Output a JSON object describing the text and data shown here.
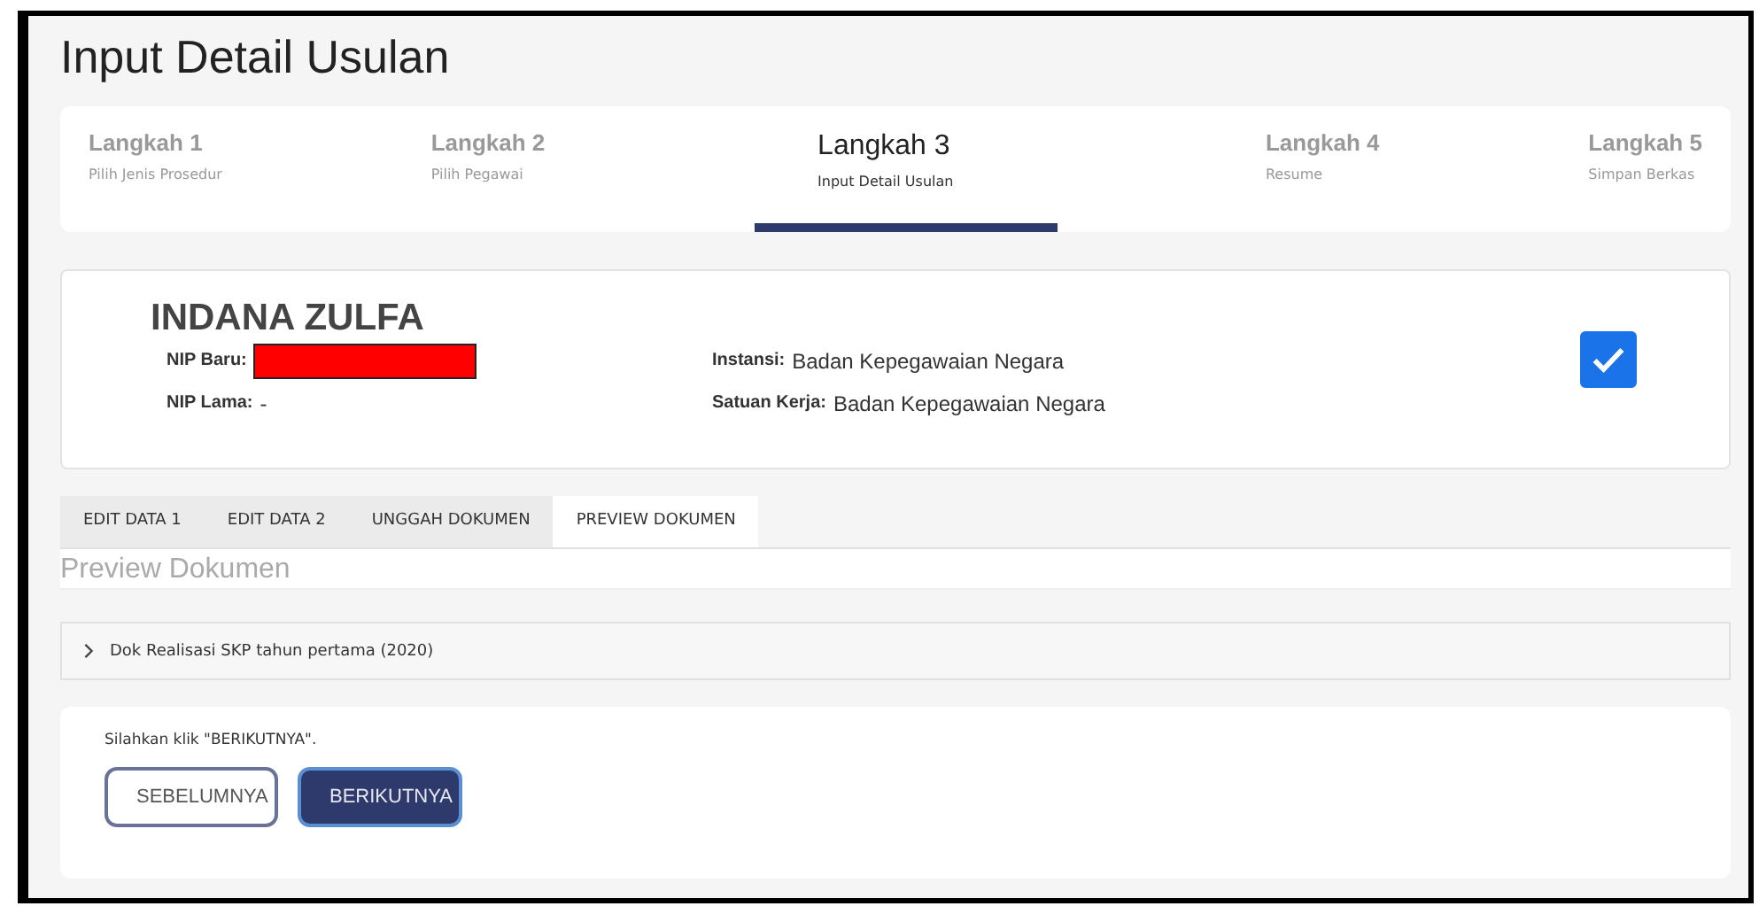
{
  "page_title": "Input Detail Usulan",
  "steps": [
    {
      "label": "Langkah 1",
      "caption": "Pilih Jenis Prosedur",
      "selected": false
    },
    {
      "label": "Langkah 2",
      "caption": "Pilih Pegawai",
      "selected": false
    },
    {
      "label": "Langkah 3",
      "caption": "Input Detail Usulan",
      "selected": true
    },
    {
      "label": "Langkah 4",
      "caption": "Resume",
      "selected": false
    },
    {
      "label": "Langkah 5",
      "caption": "Simpan Berkas",
      "selected": false
    }
  ],
  "employee": {
    "name": "INDANA ZULFA",
    "checked": true,
    "left_fields": [
      {
        "label": "NIP Baru:",
        "kind": "redacted"
      },
      {
        "label": "NIP Lama:",
        "kind": "text",
        "value": "-"
      }
    ],
    "right_fields": [
      {
        "label": "Instansi:",
        "kind": "text",
        "value": "Badan Kepegawaian Negara"
      },
      {
        "label": "Satuan Kerja:",
        "kind": "text",
        "value": "Badan Kepegawaian Negara"
      }
    ]
  },
  "tabs": [
    {
      "label": "EDIT DATA 1",
      "selected": false
    },
    {
      "label": "EDIT DATA 2",
      "selected": false
    },
    {
      "label": "UNGGAH DOKUMEN",
      "selected": false
    },
    {
      "label": "PREVIEW DOKUMEN",
      "selected": true
    }
  ],
  "section_title": "Preview Dokumen",
  "documents": [
    {
      "label": "Dok Realisasi SKP tahun pertama (2020)",
      "expanded": false
    }
  ],
  "instruction": "Silahkan klik \"BERIKUTNYA\".",
  "buttons": [
    {
      "label": "SEBELUMNYA",
      "kind": "outline"
    },
    {
      "label": "BERIKUTNYA",
      "kind": "primary"
    }
  ]
}
